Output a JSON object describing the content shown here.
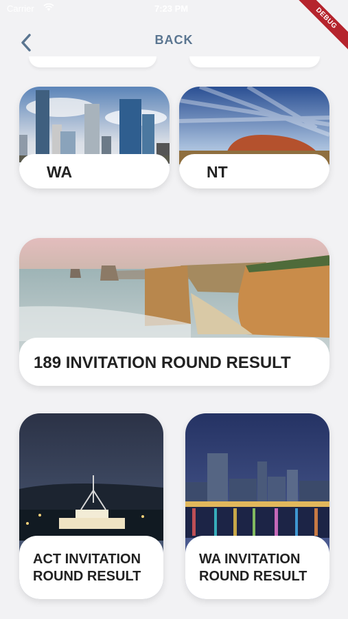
{
  "status_bar": {
    "carrier": "Carrier",
    "wifi_icon": "wifi-icon",
    "time": "7:23 PM"
  },
  "debug_banner": "DEBUG",
  "nav": {
    "back_icon": "chevron-left-icon",
    "title": "BACK"
  },
  "cards": [
    {
      "label": "WA",
      "image": "perth-city-skyline"
    },
    {
      "label": "NT",
      "image": "uluru-sunset"
    },
    {
      "label": "189 INVITATION ROUND RESULT",
      "image": "twelve-apostles-coast"
    },
    {
      "label": "ACT INVITATION ROUND RESULT",
      "image": "parliament-house-canberra"
    },
    {
      "label": "WA INVITATION ROUND RESULT",
      "image": "perth-night-skyline"
    }
  ]
}
